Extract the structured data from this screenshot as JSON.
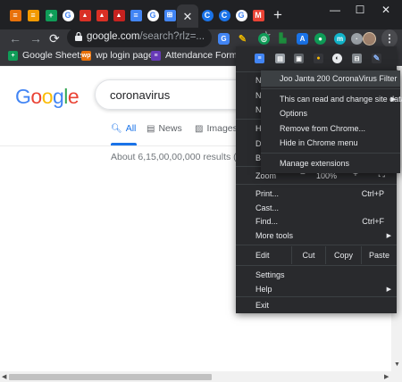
{
  "tabs": [
    {
      "icon": "tab-icon-orange-doc",
      "color": "#e8710a",
      "glyph": "≡"
    },
    {
      "icon": "tab-icon-orange-doc",
      "color": "#f29900",
      "glyph": "≡"
    },
    {
      "icon": "tab-icon-sheets",
      "color": "#0f9d58",
      "glyph": "+"
    },
    {
      "icon": "tab-icon-google",
      "color": "#ffffff",
      "glyph": "G"
    },
    {
      "icon": "tab-icon-red-site",
      "color": "#d93025",
      "glyph": "▲"
    },
    {
      "icon": "tab-icon-red-site",
      "color": "#d93025",
      "glyph": "▲"
    },
    {
      "icon": "tab-icon-red-site",
      "color": "#c5221f",
      "glyph": "▲"
    },
    {
      "icon": "tab-icon-docs",
      "color": "#4285f4",
      "glyph": "≡"
    },
    {
      "icon": "tab-icon-google",
      "color": "#ffffff",
      "glyph": "G"
    },
    {
      "icon": "tab-icon-blue-app",
      "color": "#4285f4",
      "glyph": "⊞"
    },
    {
      "icon": "tab-icon-puzzle",
      "color": "#202124",
      "glyph": "✚"
    },
    {
      "icon": "tab-icon-blue-c",
      "color": "#1a73e8",
      "glyph": "C"
    },
    {
      "icon": "tab-icon-blue-c",
      "color": "#1a73e8",
      "glyph": "C"
    },
    {
      "icon": "tab-icon-google",
      "color": "#ffffff",
      "glyph": "G"
    },
    {
      "icon": "tab-icon-gmail",
      "color": "#ea4335",
      "glyph": "M"
    }
  ],
  "toolbar": {
    "url_host": "google.com",
    "url_path": "/search?rlz=..."
  },
  "bookmarks": [
    {
      "label": "Google Sheets",
      "icon": "sheets-icon",
      "color": "#0f9d58",
      "glyph": "+"
    },
    {
      "label": "wp login page",
      "icon": "wp-icon",
      "color": "#e8710a",
      "glyph": "wp"
    },
    {
      "label": "Attendance Form in...",
      "icon": "forms-icon",
      "color": "#673ab7",
      "glyph": "≡"
    }
  ],
  "google": {
    "query": "coronavirus",
    "tabs": [
      {
        "label": "All",
        "icon": "search-icon"
      },
      {
        "label": "News",
        "icon": "news-icon"
      },
      {
        "label": "Images",
        "icon": "images-icon"
      }
    ],
    "stats": "About 6,15,00,00,000 results (0.5"
  },
  "menu": {
    "hidden_rows": [
      "N",
      "N",
      "N",
      "H",
      "D",
      "B"
    ],
    "zoom_label": "Zoom",
    "zoom_value": "100%",
    "items": [
      {
        "label": "Print...",
        "shortcut": "Ctrl+P"
      },
      {
        "label": "Cast...",
        "shortcut": ""
      },
      {
        "label": "Find...",
        "shortcut": "Ctrl+F"
      },
      {
        "label": "More tools",
        "shortcut": ""
      }
    ],
    "edit": {
      "label": "Edit",
      "cut": "Cut",
      "copy": "Copy",
      "paste": "Paste"
    },
    "settings": "Settings",
    "help": "Help",
    "exit": "Exit"
  },
  "submenu": {
    "title": "Joo Janta 200 CoronaVirus Filter",
    "site_data": "This can read and change site data",
    "options": "Options",
    "remove": "Remove from Chrome...",
    "hide": "Hide in Chrome menu",
    "manage": "Manage extensions"
  }
}
